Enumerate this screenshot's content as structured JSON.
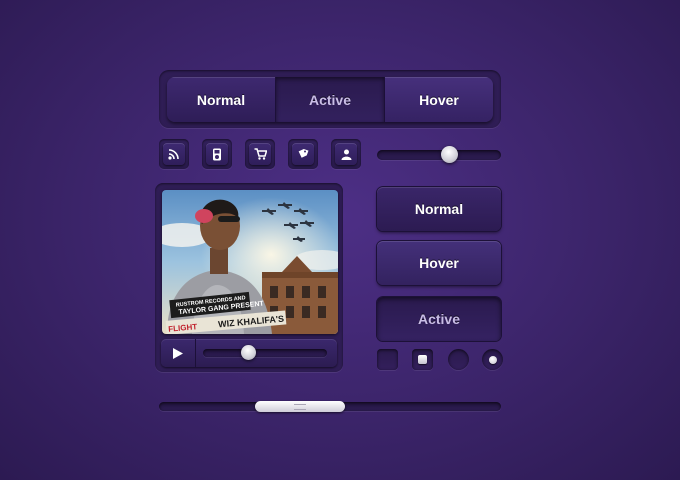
{
  "segmented": {
    "options": [
      {
        "label": "Normal",
        "state": "normal"
      },
      {
        "label": "Active",
        "state": "active"
      },
      {
        "label": "Hover",
        "state": "hover"
      }
    ]
  },
  "icons": [
    "rss-icon",
    "ipod-icon",
    "cart-icon",
    "tag-icon",
    "user-icon"
  ],
  "volume_slider": {
    "value": 0.6
  },
  "stacked_buttons": [
    {
      "label": "Normal",
      "state": "normal"
    },
    {
      "label": "Hover",
      "state": "hover"
    },
    {
      "label": "Active",
      "state": "active"
    }
  ],
  "player": {
    "cover_text": {
      "label_top": "RUSTROM RECORDS AND",
      "label_mid": "TAYLOR GANG PRESENT",
      "artist": "WIZ KHALIFA'S",
      "title_fragment": "FLIGHT"
    },
    "progress": 0.35
  },
  "controls": {
    "checkbox_unchecked": false,
    "checkbox_checked": true,
    "radio_unselected": false,
    "radio_selected": true
  },
  "scrollbar": {
    "position": 0.38
  },
  "colors": {
    "background": "#3b2469",
    "accent_text": "#ffffff",
    "active_text": "#c9bde6"
  }
}
